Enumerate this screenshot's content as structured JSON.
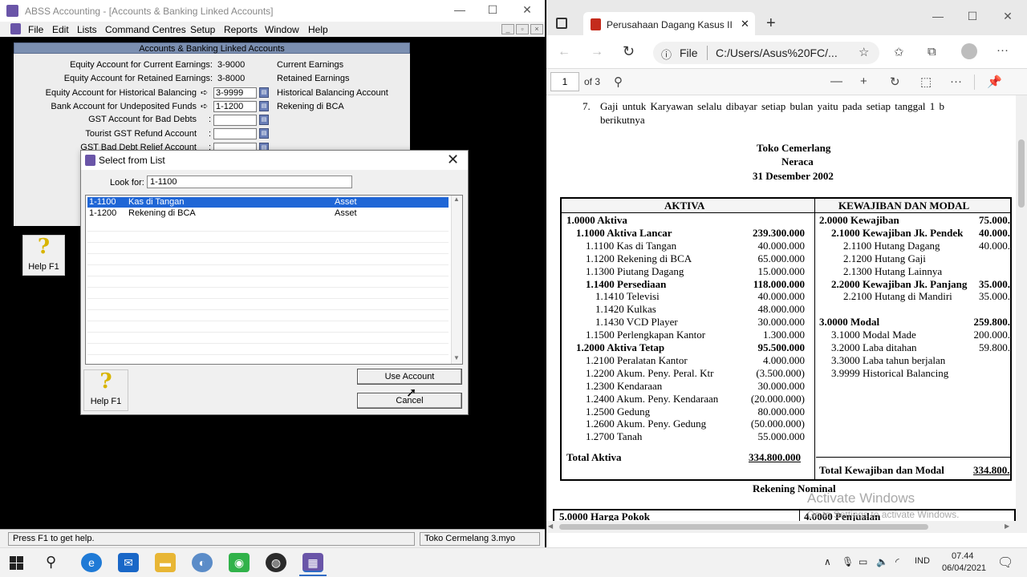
{
  "abss": {
    "title": "ABSS Accounting - [Accounts & Banking Linked Accounts]",
    "menu": [
      "File",
      "Edit",
      "Lists",
      "Command Centres",
      "Setup",
      "Reports",
      "Window",
      "Help"
    ],
    "linked_header": "Accounts & Banking Linked Accounts",
    "rows": [
      {
        "label": "Equity Account for Current Earnings:",
        "value": "3-9000",
        "name": "Current Earnings"
      },
      {
        "label": "Equity Account for Retained Earnings:",
        "value": "3-8000",
        "name": "Retained Earnings"
      },
      {
        "label": "Equity Account for Historical Balancing",
        "value": "3-9999",
        "name": "Historical Balancing Account"
      },
      {
        "label": "Bank Account for Undeposited Funds",
        "value": "1-1200",
        "name": "Rekening di BCA"
      },
      {
        "label": "GST Account for Bad Debts",
        "value": "",
        "name": ""
      },
      {
        "label": "Tourist GST Refund Account",
        "value": "",
        "name": ""
      },
      {
        "label": "GST Bad Debt Relief Account",
        "value": "",
        "name": ""
      }
    ],
    "help_label": "Help F1",
    "status_left": "Press F1 to get help.",
    "status_right": "Toko Cermelang 3.myo",
    "dialog": {
      "title": "Select from List",
      "look_for_label": "Look for:",
      "look_for_value": "1-1100",
      "items": [
        {
          "code": "1-1100",
          "name": "Kas di Tangan",
          "type": "Asset",
          "selected": true
        },
        {
          "code": "1-1200",
          "name": "Rekening di BCA",
          "type": "Asset",
          "selected": false
        }
      ],
      "use_account": "Use Account",
      "cancel": "Cancel",
      "help_label": "Help F1"
    }
  },
  "edge": {
    "tab_title": "Perusahaan Dagang Kasus II (UT",
    "url_prefix": "File",
    "url": "C:/Users/Asus%20FC/...",
    "page_current": "1",
    "page_total": "of 3",
    "doc": {
      "item7": "7.",
      "item7_line1": "Gaji untuk Karyawan selalu dibayar setiap bulan yaitu pada setiap tanggal 1 b",
      "item7_line2": "berikutnya",
      "company": "Toko Cemerlang",
      "report": "Neraca",
      "date": "31 Desember 2002",
      "col_left": "AKTIVA",
      "col_right": "KEWAJIBAN DAN MODAL",
      "left_rows": [
        {
          "label": "1.0000 Aktiva",
          "amount": "",
          "bold": true,
          "indent": 0
        },
        {
          "label": "1.1000 Aktiva Lancar",
          "amount": "239.300.000",
          "bold": true,
          "indent": 1
        },
        {
          "label": "1.1100 Kas di Tangan",
          "amount": "40.000.000",
          "bold": false,
          "indent": 2
        },
        {
          "label": "1.1200 Rekening di BCA",
          "amount": "65.000.000",
          "bold": false,
          "indent": 2
        },
        {
          "label": "1.1300 Piutang Dagang",
          "amount": "15.000.000",
          "bold": false,
          "indent": 2
        },
        {
          "label": "1.1400 Persediaan",
          "amount": "118.000.000",
          "bold": true,
          "indent": 2
        },
        {
          "label": "1.1410 Televisi",
          "amount": "40.000.000",
          "bold": false,
          "indent": 3
        },
        {
          "label": "1.1420 Kulkas",
          "amount": "48.000.000",
          "bold": false,
          "indent": 3
        },
        {
          "label": "1.1430 VCD Player",
          "amount": "30.000.000",
          "bold": false,
          "indent": 3
        },
        {
          "label": "1.1500 Perlengkapan Kantor",
          "amount": "1.300.000",
          "bold": false,
          "indent": 2
        },
        {
          "label": "1.2000 Aktiva Tetap",
          "amount": "95.500.000",
          "bold": true,
          "indent": 1
        },
        {
          "label": "1.2100 Peralatan Kantor",
          "amount": "4.000.000",
          "bold": false,
          "indent": 2
        },
        {
          "label": "1.2200 Akum. Peny. Peral. Ktr",
          "amount": "(3.500.000)",
          "bold": false,
          "indent": 2
        },
        {
          "label": "1.2300 Kendaraan",
          "amount": "30.000.000",
          "bold": false,
          "indent": 2
        },
        {
          "label": "1.2400 Akum. Peny. Kendaraan",
          "amount": "(20.000.000)",
          "bold": false,
          "indent": 2
        },
        {
          "label": "1.2500 Gedung",
          "amount": "80.000.000",
          "bold": false,
          "indent": 2
        },
        {
          "label": "1.2600 Akum. Peny. Gedung",
          "amount": "(50.000.000)",
          "bold": false,
          "indent": 2
        },
        {
          "label": "1.2700 Tanah",
          "amount": "55.000.000",
          "bold": false,
          "indent": 2
        }
      ],
      "right_rows": [
        {
          "label": "2.0000 Kewajiban",
          "amount": "75.000.",
          "bold": true,
          "indent": 0
        },
        {
          "label": "2.1000 Kewajiban Jk. Pendek",
          "amount": "40.000.",
          "bold": true,
          "indent": 1
        },
        {
          "label": "2.1100 Hutang Dagang",
          "amount": "40.000.",
          "bold": false,
          "indent": 2
        },
        {
          "label": "2.1200 Hutang Gaji",
          "amount": "",
          "bold": false,
          "indent": 2
        },
        {
          "label": "2.1300 Hutang Lainnya",
          "amount": "",
          "bold": false,
          "indent": 2
        },
        {
          "label": "2.2000 Kewajiban Jk. Panjang",
          "amount": "35.000.",
          "bold": true,
          "indent": 1
        },
        {
          "label": "2.2100 Hutang di Mandiri",
          "amount": "35.000.",
          "bold": false,
          "indent": 2
        },
        {
          "label": "",
          "amount": "",
          "bold": false,
          "indent": 0
        },
        {
          "label": "3.0000 Modal",
          "amount": "259.800.",
          "bold": true,
          "indent": 0
        },
        {
          "label": "3.1000 Modal Made",
          "amount": "200.000.",
          "bold": false,
          "indent": 1
        },
        {
          "label": "3.2000 Laba ditahan",
          "amount": "59.800.",
          "bold": false,
          "indent": 1
        },
        {
          "label": "3.3000 Laba tahun berjalan",
          "amount": "",
          "bold": false,
          "indent": 1
        },
        {
          "label": "3.9999 Historical Balancing",
          "amount": "",
          "bold": false,
          "indent": 1
        }
      ],
      "total_left_label": "Total Aktiva",
      "total_left_amount": "334.800.000",
      "total_right_label": "Total Kewajiban dan Modal",
      "total_right_amount": "334.800.",
      "nominal": "Rekening Nominal",
      "bottom_left": "5.0000 Harga Pokok",
      "bottom_right": "4.0000 Penjualan"
    },
    "watermark1": "Activate Windows",
    "watermark2": "Go to Settings to activate Windows."
  },
  "taskbar": {
    "lang": "IND",
    "time": "07.44",
    "date": "06/04/2021"
  }
}
